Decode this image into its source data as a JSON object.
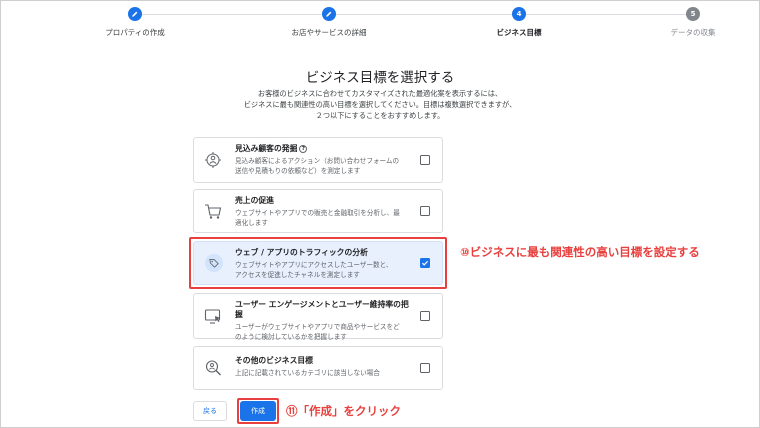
{
  "stepper": {
    "steps": [
      {
        "label": "プロパティの作成",
        "state": "done"
      },
      {
        "label": "お店やサービスの詳細",
        "state": "done"
      },
      {
        "label": "ビジネス目標",
        "state": "active",
        "number": "4"
      },
      {
        "label": "データの収集",
        "state": "pending",
        "number": "5"
      }
    ]
  },
  "heading": {
    "title": "ビジネス目標を選択する",
    "desc1": "お客様のビジネスに合わせてカスタマイズされた最適化案を表示するには、",
    "desc2": "ビジネスに最も関連性の高い目標を選択してください。目標は複数選択できますが、",
    "desc3": "２つ以下にすることをおすすめします。"
  },
  "options": [
    {
      "title": "見込み顧客の発掘",
      "help": "?",
      "desc1": "見込み顧客によるアクション（お問い合わせフォームの",
      "desc2": "送信や見積もりの依頼など）を測定します",
      "checked": false,
      "icon": "target-person-icon"
    },
    {
      "title": "売上の促進",
      "desc1": "ウェブサイトやアプリでの販売と金融取引を分析し、最",
      "desc2": "適化します",
      "checked": false,
      "icon": "shopping-cart-icon"
    },
    {
      "title": "ウェブ / アプリのトラフィックの分析",
      "desc1": "ウェブサイトやアプリにアクセスしたユーザー数と、",
      "desc2": "アクセスを促進したチャネルを測定します",
      "checked": true,
      "icon": "tag-icon"
    },
    {
      "title": "ユーザー エンゲージメントとユーザー維持率の把",
      "title2": "握",
      "desc1": "ユーザーがウェブサイトやアプリで商品やサービスをど",
      "desc2": "のように検討しているかを把握します",
      "checked": false,
      "icon": "monitor-cursor-icon"
    },
    {
      "title": "その他のビジネス目標",
      "desc1": "上記に記載されているカテゴリに該当しない場合",
      "checked": false,
      "icon": "magnifier-person-icon"
    }
  ],
  "buttons": {
    "back": "戻る",
    "create": "作成"
  },
  "annotations": {
    "goal": "⑩ビジネスに最も関連性の高い目標を設定する",
    "create": "⑪「作成」をクリック"
  },
  "colors": {
    "primary": "#1a73e8",
    "annotation": "#e8403e",
    "selected_bg": "#e8f0fe"
  }
}
